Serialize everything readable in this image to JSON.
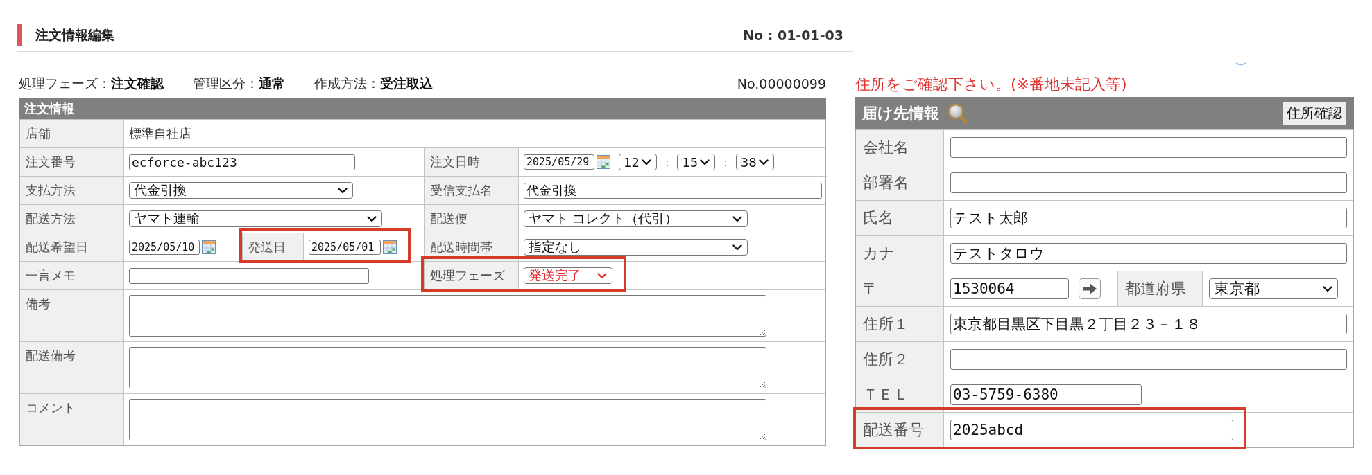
{
  "page_header": {
    "title": "注文情報編集",
    "number": "No : 01-01-03"
  },
  "summary": {
    "items": [
      "処理フェーズ：**注文確認**",
      "管理区分：**通常**",
      "作成方法：**受注取込**"
    ],
    "order_no": "No.00000099"
  },
  "order_info": {
    "title": "注文情報",
    "rows": [
      {
        "cells": [
          {
            "label": "店舗",
            "highlighted": false,
            "field": {
              "kind": "text",
              "value": "標準自社店"
            }
          }
        ]
      },
      {
        "cells": [
          {
            "label": "注文番号",
            "highlighted": false,
            "field": {
              "kind": "input",
              "value": "ecforce-abc123"
            }
          },
          {
            "label": "注文日時",
            "highlighted": false,
            "field": {
              "kind": "datetime",
              "date": "2025/05/29",
              "time": [
                "12",
                "15",
                "38"
              ],
              "separators": [
                ":",
                ":"
              ]
            }
          }
        ]
      },
      {
        "cells": [
          {
            "label": "支払方法",
            "highlighted": false,
            "field": {
              "kind": "select",
              "value": "代金引換",
              "alert": false
            }
          },
          {
            "label": "受信支払名",
            "highlighted": false,
            "field": {
              "kind": "input",
              "value": "代金引換"
            }
          }
        ]
      },
      {
        "cells": [
          {
            "label": "配送方法",
            "highlighted": false,
            "field": {
              "kind": "select",
              "value": "ヤマト運輸",
              "alert": false
            }
          },
          {
            "label": "配送便",
            "highlighted": false,
            "field": {
              "kind": "select",
              "value": "ヤマト コレクト（代引）",
              "alert": false
            }
          }
        ]
      },
      {
        "cells": [
          {
            "label": "配送希望日",
            "highlighted": false,
            "field": {
              "kind": "date",
              "value": "2025/05/10"
            }
          },
          {
            "label": "発送日",
            "highlighted": true,
            "field": {
              "kind": "date",
              "value": "2025/05/01"
            }
          },
          {
            "label": "配送時間帯",
            "highlighted": false,
            "field": {
              "kind": "select",
              "value": "指定なし",
              "alert": false
            }
          }
        ]
      },
      {
        "cells": [
          {
            "label": "一言メモ",
            "highlighted": false,
            "field": {
              "kind": "input"
            }
          },
          {
            "label": "処理フェーズ",
            "highlighted": true,
            "field": {
              "kind": "select",
              "value": "発送完了",
              "alert": true
            }
          }
        ]
      },
      {
        "cells": [
          {
            "label": "備考",
            "highlighted": false,
            "field": {
              "kind": "textarea"
            }
          }
        ]
      },
      {
        "cells": [
          {
            "label": "配送備考",
            "highlighted": false,
            "field": {
              "kind": "textarea"
            }
          }
        ]
      },
      {
        "cells": [
          {
            "label": "コメント",
            "highlighted": false,
            "field": {
              "kind": "textarea"
            }
          }
        ]
      }
    ]
  },
  "shipping_info": {
    "warning": "住所をご確認下さい。(※番地未記入等)",
    "title": "届け先情報",
    "confirm_button": "住所確認",
    "rows": [
      {
        "cells": [
          {
            "label": "会社名",
            "highlighted": false,
            "field": {
              "kind": "input"
            }
          }
        ]
      },
      {
        "cells": [
          {
            "label": "部署名",
            "highlighted": false,
            "field": {
              "kind": "input"
            }
          }
        ]
      },
      {
        "cells": [
          {
            "label": "氏名",
            "highlighted": false,
            "field": {
              "kind": "input",
              "value": "テスト太郎"
            }
          }
        ]
      },
      {
        "cells": [
          {
            "label": "カナ",
            "highlighted": false,
            "field": {
              "kind": "input",
              "value": "テストタロウ"
            }
          }
        ]
      },
      {
        "cells": [
          {
            "label": "〒",
            "highlighted": false,
            "field": {
              "kind": "postal",
              "value": "1530064"
            }
          },
          {
            "label": "都道府県",
            "highlighted": false,
            "field": {
              "kind": "select",
              "value": "東京都",
              "alert": false
            }
          }
        ]
      },
      {
        "cells": [
          {
            "label": "住所１",
            "highlighted": false,
            "field": {
              "kind": "input",
              "value": "東京都目黒区下目黒２丁目２３－１８"
            }
          }
        ]
      },
      {
        "cells": [
          {
            "label": "住所２",
            "highlighted": false,
            "field": {
              "kind": "input"
            }
          }
        ]
      },
      {
        "cells": [
          {
            "label": "ＴＥＬ",
            "highlighted": false,
            "field": {
              "kind": "input",
              "value": "03-5759-6380"
            }
          }
        ]
      },
      {
        "cells": [
          {
            "label": "配送番号",
            "highlighted": true,
            "field": {
              "kind": "input",
              "value": "2025abcd"
            }
          }
        ]
      }
    ]
  }
}
